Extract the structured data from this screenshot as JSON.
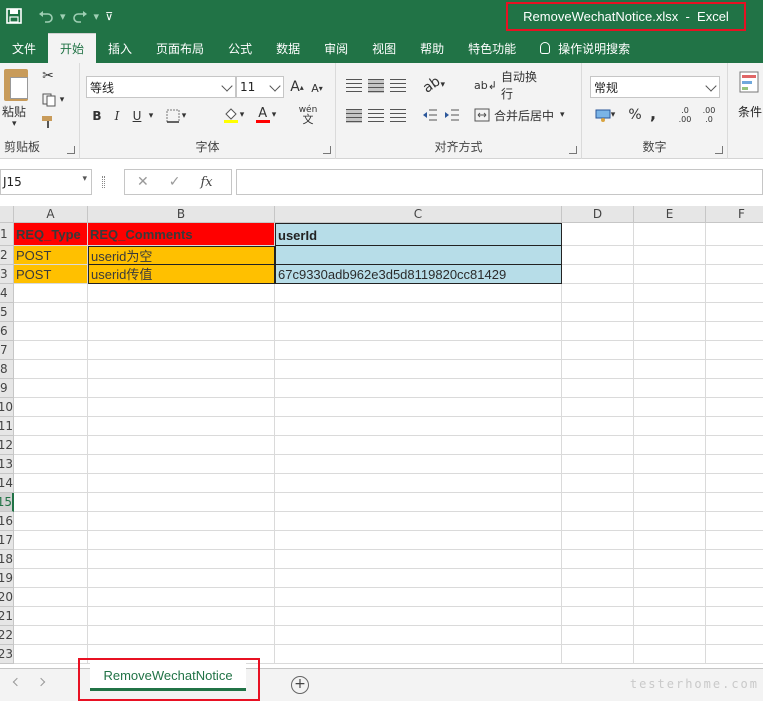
{
  "window": {
    "title": "RemoveWechatNotice.xlsx  -  Excel"
  },
  "qat": {
    "save_icon": "save-icon",
    "undo_icon": "undo-icon",
    "redo_icon": "redo-icon",
    "customize_icon": "customize-qat-icon"
  },
  "tabs": [
    {
      "label": "文件",
      "active": false
    },
    {
      "label": "开始",
      "active": true
    },
    {
      "label": "插入",
      "active": false
    },
    {
      "label": "页面布局",
      "active": false
    },
    {
      "label": "公式",
      "active": false
    },
    {
      "label": "数据",
      "active": false
    },
    {
      "label": "审阅",
      "active": false
    },
    {
      "label": "视图",
      "active": false
    },
    {
      "label": "帮助",
      "active": false
    },
    {
      "label": "特色功能",
      "active": false
    }
  ],
  "tell_me": {
    "label": "操作说明搜索"
  },
  "ribbon": {
    "clipboard": {
      "label": "剪贴板",
      "paste_label": "粘贴"
    },
    "font": {
      "label": "字体",
      "font_name": "等线",
      "font_size": "11",
      "bold": "B",
      "italic": "I",
      "underline": "U",
      "grow": "A",
      "shrink": "A",
      "font_color": "A",
      "phonetic": "wén"
    },
    "alignment": {
      "label": "对齐方式",
      "wrap_text": "自动换行",
      "merge_center": "合并后居中"
    },
    "number": {
      "label": "数字",
      "format": "常规",
      "percent": "%",
      "comma": ",",
      "inc_decimal": ".00",
      "dec_decimal": ".0"
    },
    "styles": {
      "label": "条件"
    }
  },
  "formula_bar": {
    "name_box": "J15",
    "cancel": "✕",
    "enter": "✓",
    "fx": "fx",
    "value": ""
  },
  "grid": {
    "columns": [
      "A",
      "B",
      "C",
      "D",
      "E",
      "F"
    ],
    "rows": [
      "1",
      "2",
      "3",
      "4",
      "5",
      "6",
      "7",
      "8",
      "9",
      "10",
      "11",
      "12",
      "13",
      "14",
      "15",
      "16",
      "17",
      "18",
      "19",
      "20",
      "21",
      "22",
      "23"
    ],
    "active_row": "15",
    "cells": {
      "A1": "REQ_Type",
      "B1": "REQ_Comments",
      "C1": "userId",
      "A2": "POST",
      "B2": "userid为空",
      "C2": "",
      "A3": "POST",
      "B3": "userid传值",
      "C3": "67c9330adb962e3d5d8119820cc81429"
    },
    "colors": {
      "header_red": "#ff0000",
      "header_blue": "#b7dde8",
      "orange": "#ffc000"
    }
  },
  "sheets": [
    {
      "name": "RemoveWechatNotice",
      "active": true
    }
  ],
  "watermark": "testerhome.com"
}
